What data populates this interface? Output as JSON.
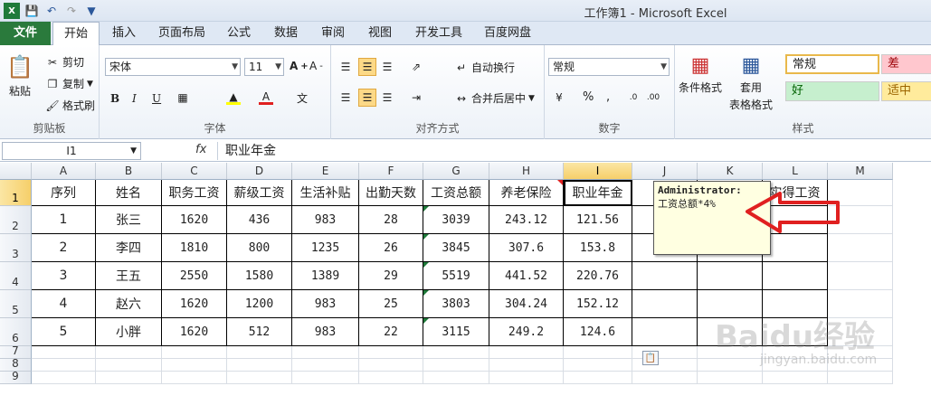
{
  "window": {
    "title": "工作簿1 - Microsoft Excel"
  },
  "tabs": [
    "文件",
    "开始",
    "插入",
    "页面布局",
    "公式",
    "数据",
    "审阅",
    "视图",
    "开发工具",
    "百度网盘"
  ],
  "ribbon": {
    "clipboard": {
      "paste": "粘贴",
      "cut": "剪切",
      "copy": "复制",
      "format_painter": "格式刷",
      "label": "剪贴板"
    },
    "font": {
      "name": "宋体",
      "size": "11",
      "label": "字体",
      "bold": "B",
      "italic": "I",
      "underline": "U"
    },
    "alignment": {
      "wrap": "自动换行",
      "merge": "合并后居中",
      "label": "对齐方式"
    },
    "number": {
      "format": "常规",
      "percent": "%",
      "comma": ",",
      "label": "数字"
    },
    "styles": {
      "conditional": "条件格式",
      "table": "套用",
      "table2": "表格格式",
      "normal": "常规",
      "bad": "差",
      "good": "好",
      "neutral": "适中",
      "label": "样式"
    }
  },
  "formula_bar": {
    "name_box": "I1",
    "fx": "fx",
    "value": "职业年金"
  },
  "columns": [
    "A",
    "B",
    "C",
    "D",
    "E",
    "F",
    "G",
    "H",
    "I",
    "J",
    "K",
    "L",
    "M"
  ],
  "rows": [
    "1",
    "2",
    "3",
    "4",
    "5",
    "6",
    "7",
    "8",
    "9"
  ],
  "headers": [
    "序列",
    "姓名",
    "职务工资",
    "薪级工资",
    "生活补贴",
    "出勤天数",
    "工资总额",
    "养老保险",
    "职业年金",
    "医",
    "",
    "实得工资"
  ],
  "data": [
    [
      "1",
      "张三",
      "1620",
      "436",
      "983",
      "28",
      "3039",
      "243.12",
      "121.56"
    ],
    [
      "2",
      "李四",
      "1810",
      "800",
      "1235",
      "26",
      "3845",
      "307.6",
      "153.8"
    ],
    [
      "3",
      "王五",
      "2550",
      "1580",
      "1389",
      "29",
      "5519",
      "441.52",
      "220.76"
    ],
    [
      "4",
      "赵六",
      "1620",
      "1200",
      "983",
      "25",
      "3803",
      "304.24",
      "152.12"
    ],
    [
      "5",
      "小胖",
      "1620",
      "512",
      "983",
      "22",
      "3115",
      "249.2",
      "124.6"
    ]
  ],
  "comment": {
    "author": "Administrator:",
    "text": "工资总额*4%"
  },
  "watermark": {
    "brand": "Baidu经验",
    "url": "jingyan.baidu.com"
  },
  "colors": {
    "file_tab": "#2a7a3c",
    "selected_header": "#f6cf6a",
    "arrow": "#e02020",
    "comment_bg": "#ffffe1"
  }
}
